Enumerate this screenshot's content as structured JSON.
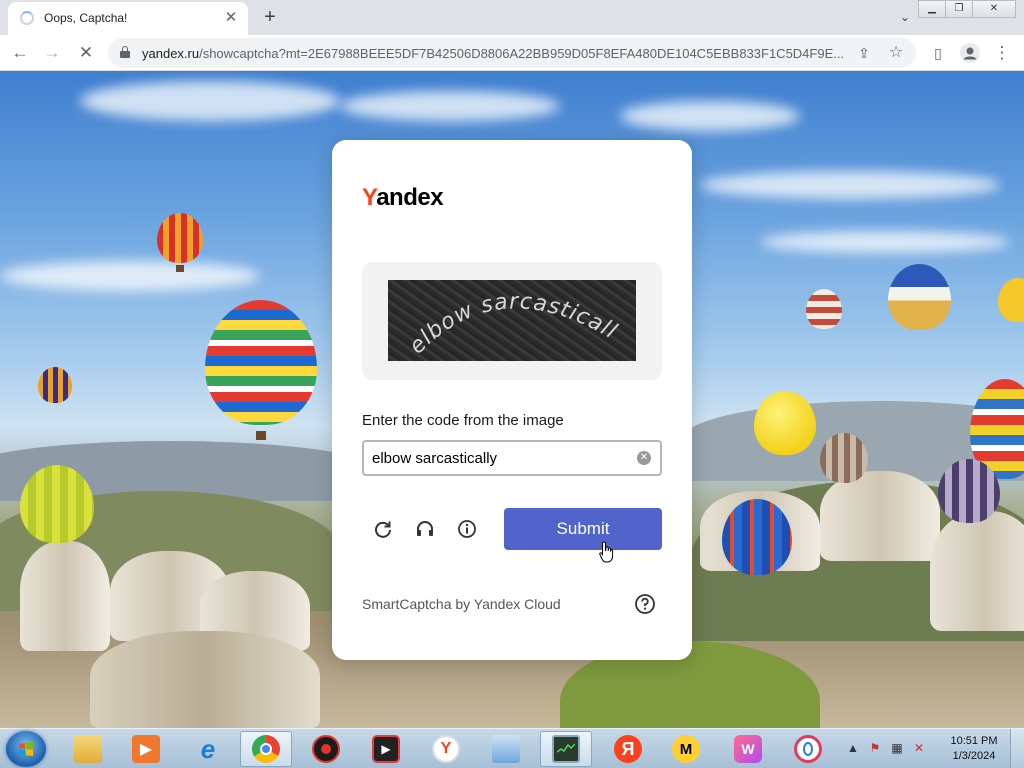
{
  "browser": {
    "tab_title": "Oops, Captcha!",
    "url_host": "yandex.ru",
    "url_rest": "/showcaptcha?mt=2E67988BEEE5DF7B42506D8806A22BB959D05F8EFA480DE104C5EBB833F1C5D4F9E..."
  },
  "captcha": {
    "logo_y": "Y",
    "logo_rest": "andex",
    "image_text": "elbow sarcastically",
    "prompt": "Enter the code from the image",
    "answer_value": "elbow sarcastically",
    "submit_label": "Submit",
    "footer": "SmartCaptcha by Yandex Cloud",
    "accent": "#5164cc"
  },
  "taskbar": {
    "items": [
      "file-explorer",
      "media-player",
      "internet-explorer",
      "chrome",
      "screen-recorder",
      "video-camera",
      "yandex-browser",
      "control-panel",
      "task-manager",
      "yandex-app",
      "miro",
      "wps-office",
      "opera-gx"
    ],
    "time": "10:51 PM",
    "date": "1/3/2024"
  }
}
